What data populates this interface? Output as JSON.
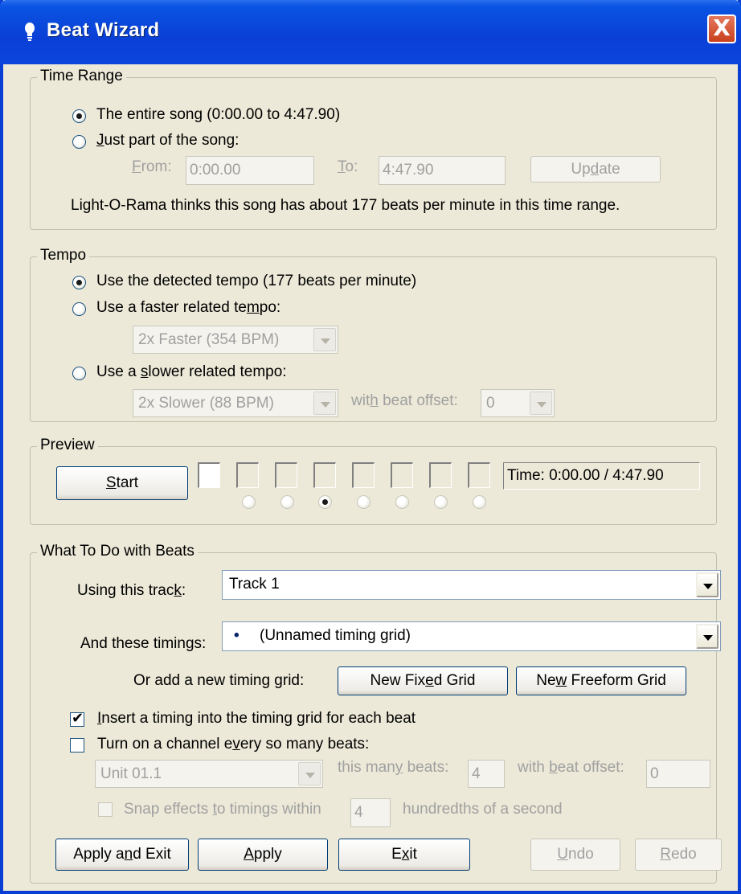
{
  "window": {
    "title": "Beat Wizard",
    "close_symbol": "X"
  },
  "time_range": {
    "legend": "Time Range",
    "entire_song": "The entire song (0:00.00 to 4:47.90)",
    "just_part": {
      "pre": "",
      "u": "J",
      "post": "ust part of the song:"
    },
    "from_label": {
      "pre": "",
      "u": "F",
      "post": "rom:"
    },
    "from_value": "0:00.00",
    "to_label": {
      "pre": "",
      "u": "T",
      "post": "o:"
    },
    "to_value": "4:47.90",
    "update_button": {
      "pre": "Up",
      "u": "d",
      "post": "ate"
    },
    "info": "Light-O-Rama thinks this song has about 177 beats per minute in this time range."
  },
  "tempo": {
    "legend": "Tempo",
    "detected": "Use the detected tempo (177 beats per minute)",
    "faster": {
      "pre": "Use a faster related te",
      "u": "m",
      "post": "po:"
    },
    "faster_select": "2x Faster (354 BPM)",
    "slower": {
      "pre": "Use a ",
      "u": "s",
      "post": "lower related tempo:"
    },
    "slower_select": "2x Slower (88 BPM)",
    "offset_label": {
      "pre": "wit",
      "u": "h",
      "post": " beat offset:"
    },
    "offset_select": "0"
  },
  "preview": {
    "legend": "Preview",
    "start_button": {
      "pre": "",
      "u": "S",
      "post": "tart"
    },
    "time": "Time: 0:00.00 / 4:47.90"
  },
  "beats": {
    "legend": "What To Do with Beats",
    "track_label": {
      "pre": "Using this trac",
      "u": "k",
      "post": ":"
    },
    "track_value": "Track 1",
    "timings_label": "And these timings:",
    "timings_bullet": "•",
    "timings_value": "(Unnamed timing grid)",
    "new_grid_label": "Or add a new timing grid:",
    "new_fixed_button": {
      "pre": "New Fix",
      "u": "e",
      "post": "d Grid"
    },
    "new_freeform_button": {
      "pre": "Ne",
      "u": "w",
      "post": " Freeform Grid"
    },
    "insert_timing": {
      "pre": "",
      "u": "I",
      "post": "nsert a timing into the timing grid for each beat"
    },
    "turn_on_channel": {
      "pre": "Turn on a channel e",
      "u": "v",
      "post": "ery so many beats:"
    },
    "unit_select": "Unit 01.1",
    "many_beats_label": {
      "pre": "this man",
      "u": "y",
      "post": " beats:"
    },
    "many_beats_value": "4",
    "beat_offset_label": {
      "pre": "with ",
      "u": "b",
      "post": "eat offset:"
    },
    "beat_offset_value": "0",
    "snap_label": {
      "pre": "Snap effects ",
      "u": "t",
      "post": "o timings within"
    },
    "snap_value": "4",
    "snap_unit": "hundredths of a second"
  },
  "footer": {
    "apply_exit": {
      "pre": "Apply a",
      "u": "n",
      "post": "d Exit"
    },
    "apply": {
      "pre": "",
      "u": "A",
      "post": "pply"
    },
    "exit": {
      "pre": "E",
      "u": "x",
      "post": "it"
    },
    "undo": {
      "pre": "",
      "u": "U",
      "post": "ndo"
    },
    "redo": {
      "pre": "",
      "u": "R",
      "post": "edo"
    }
  },
  "colors": {
    "title_bar": "#0a3fd6",
    "dialog_bg": "#ece9d8",
    "close_button": "#d35c3a",
    "radio_dot": "#21a121"
  }
}
